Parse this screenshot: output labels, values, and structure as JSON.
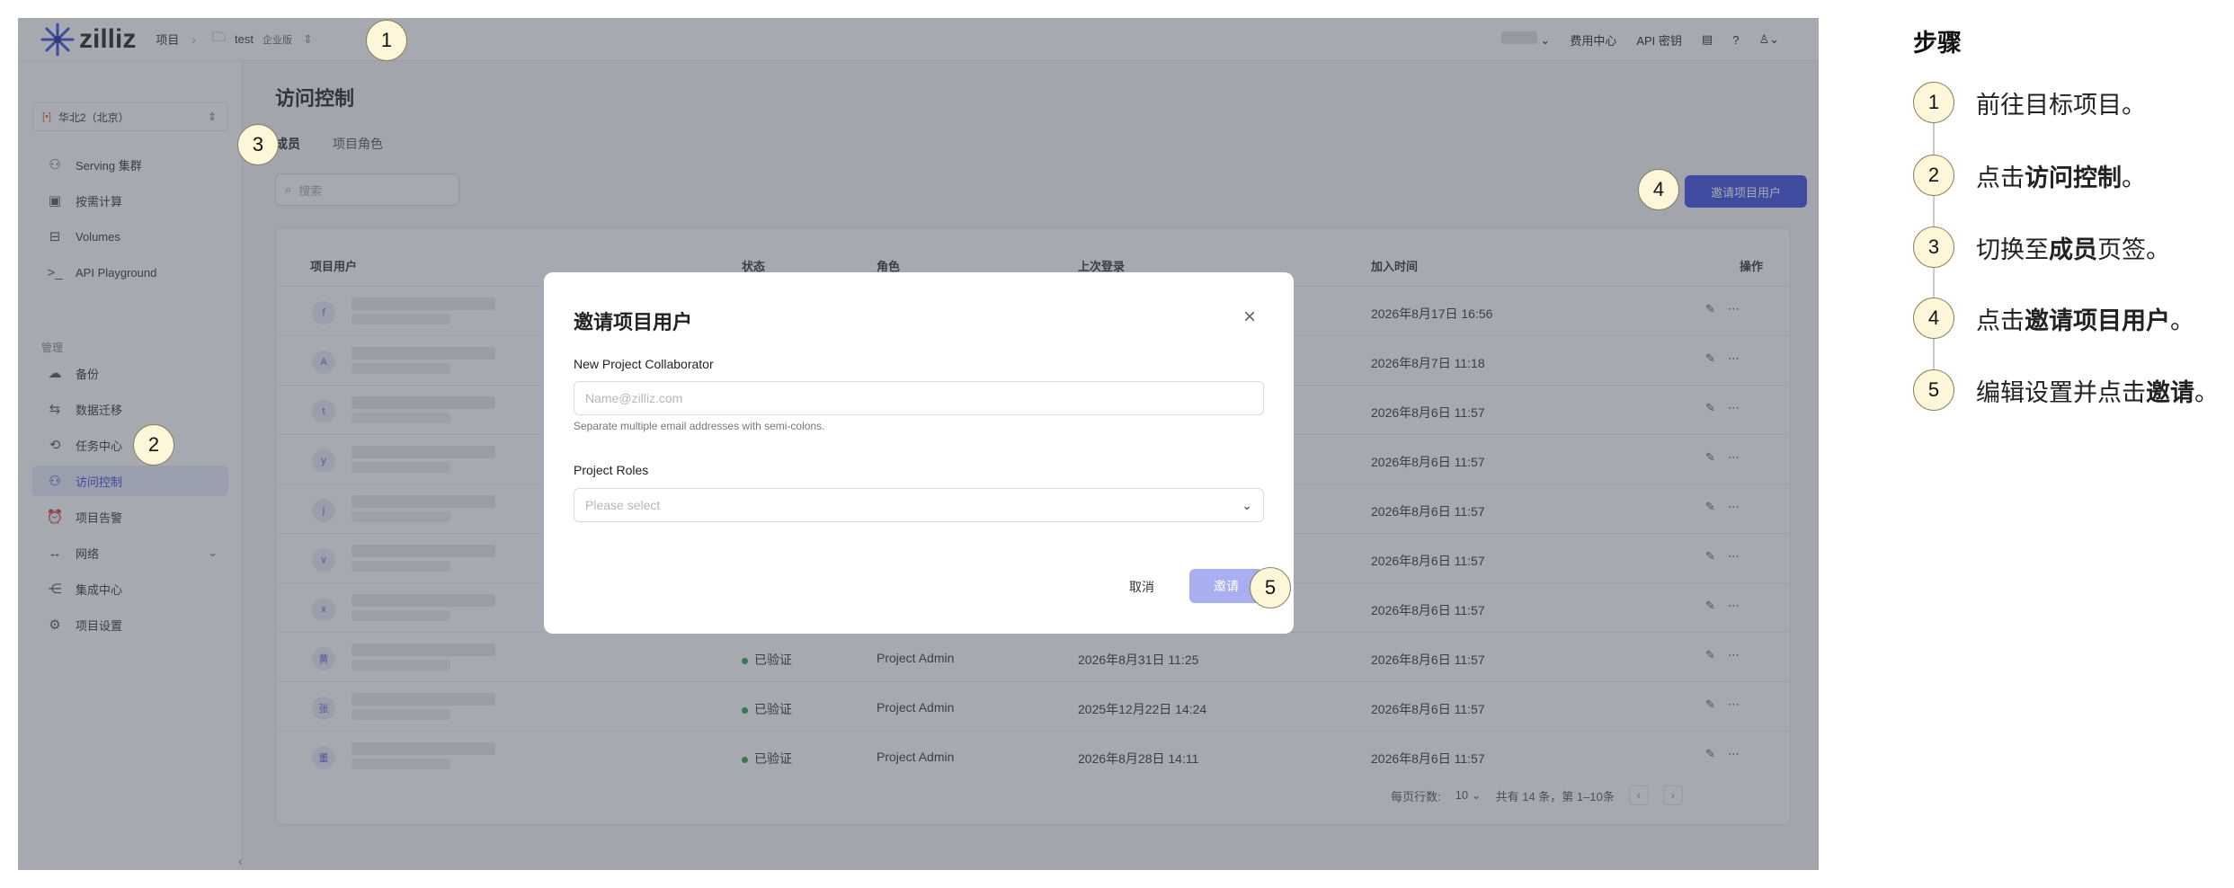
{
  "app": {
    "logo_text": "zilliz",
    "breadcrumb": {
      "project_label": "项目",
      "project_name": "test",
      "plan_badge": "企业版"
    },
    "topbar": {
      "billing": "费用中心",
      "api_key": "API 密钥"
    }
  },
  "sidebar": {
    "region": "华北2（北京）",
    "items": [
      {
        "label": "Serving 集群",
        "icon": "cluster-icon"
      },
      {
        "label": "按需计算",
        "icon": "compute-icon"
      },
      {
        "label": "Volumes",
        "icon": "volumes-icon"
      },
      {
        "label": "API Playground",
        "icon": "terminal-icon"
      }
    ],
    "group_label": "管理",
    "manage_items": [
      {
        "label": "备份",
        "icon": "cloud-backup-icon"
      },
      {
        "label": "数据迁移",
        "icon": "migration-icon"
      },
      {
        "label": "任务中心",
        "icon": "history-icon"
      },
      {
        "label": "访问控制",
        "icon": "users-icon",
        "active": true
      },
      {
        "label": "项目告警",
        "icon": "alarm-icon"
      },
      {
        "label": "网络",
        "icon": "network-icon",
        "expandable": true
      },
      {
        "label": "集成中心",
        "icon": "integration-icon"
      },
      {
        "label": "项目设置",
        "icon": "settings-icon"
      }
    ]
  },
  "main": {
    "title": "访问控制",
    "tabs": [
      "成员",
      "项目角色"
    ],
    "search_placeholder": "搜索",
    "invite_button": "邀请项目用户",
    "table": {
      "headers": [
        "项目用户",
        "状态",
        "角色",
        "上次登录",
        "加入时间",
        "操作"
      ],
      "rows": [
        {
          "avatar": "f",
          "status": "",
          "role": "",
          "last_login": "",
          "joined": "2026年8月17日 16:56"
        },
        {
          "avatar": "A",
          "status": "",
          "role": "",
          "last_login": "",
          "joined": "2026年8月7日 11:18"
        },
        {
          "avatar": "t",
          "status": "",
          "role": "",
          "last_login": "",
          "joined": "2026年8月6日 11:57"
        },
        {
          "avatar": "y",
          "status": "",
          "role": "",
          "last_login": "",
          "joined": "2026年8月6日 11:57"
        },
        {
          "avatar": "j",
          "status": "",
          "role": "",
          "last_login": "",
          "joined": "2026年8月6日 11:57"
        },
        {
          "avatar": "v",
          "status": "",
          "role": "",
          "last_login": "",
          "joined": "2026年8月6日 11:57"
        },
        {
          "avatar": "x",
          "status": "",
          "role": "",
          "last_login": "",
          "joined": "2026年8月6日 11:57"
        },
        {
          "avatar": "黄",
          "status": "已验证",
          "role": "Project Admin",
          "last_login": "2026年8月31日 11:25",
          "joined": "2026年8月6日 11:57"
        },
        {
          "avatar": "张",
          "status": "已验证",
          "role": "Project Admin",
          "last_login": "2025年12月22日 14:24",
          "joined": "2026年8月6日 11:57"
        },
        {
          "avatar": "董",
          "status": "已验证",
          "role": "Project Admin",
          "last_login": "2026年8月28日 14:11",
          "joined": "2026年8月6日 11:57"
        }
      ]
    },
    "pager": {
      "rows_label": "每页行数:",
      "rows_value": "10",
      "summary": "共有 14 条，第 1–10条"
    }
  },
  "modal": {
    "title": "邀请项目用户",
    "collaborator_label": "New Project Collaborator",
    "email_placeholder": "Name@zilliz.com",
    "email_hint": "Separate multiple email addresses with semi-colons.",
    "roles_label": "Project Roles",
    "roles_placeholder": "Please select",
    "cancel": "取消",
    "invite": "邀请"
  },
  "callouts": [
    "1",
    "2",
    "3",
    "4",
    "5"
  ],
  "steps": {
    "title": "步骤",
    "items": [
      {
        "num": "1",
        "before": "前往目标项目。",
        "bold": "",
        "after": ""
      },
      {
        "num": "2",
        "before": "点击",
        "bold": "访问控制",
        "after": "。"
      },
      {
        "num": "3",
        "before": "切换至",
        "bold": "成员",
        "after": "页签。"
      },
      {
        "num": "4",
        "before": "点击",
        "bold": "邀请项目用户",
        "after": "。"
      },
      {
        "num": "5",
        "before": "编辑设置并点击",
        "bold": "邀请",
        "after": "。"
      }
    ]
  },
  "colors": {
    "accent": "#3d4de0",
    "badge_fill": "#fdf6d8",
    "verified": "#2ca04c"
  }
}
